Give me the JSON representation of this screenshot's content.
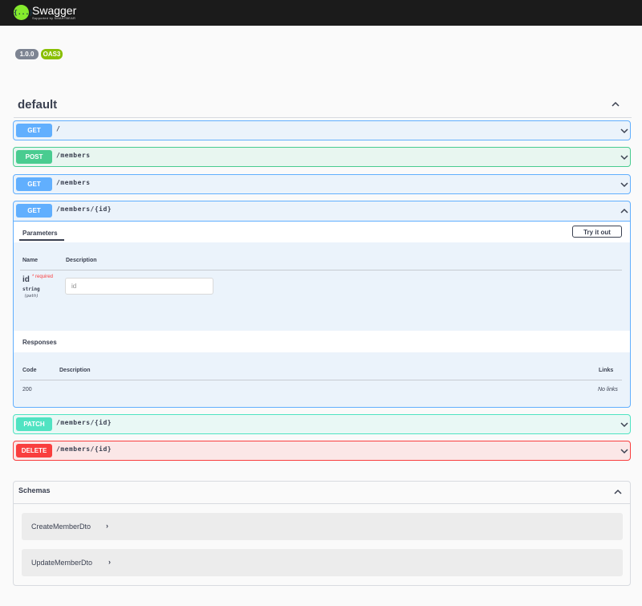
{
  "topbar": {
    "brand": "Swagger",
    "subtitle": "Supported by SMARTBEAR",
    "logo_glyph": "{...}"
  },
  "info": {
    "version": "1.0.0",
    "oas": "OAS3"
  },
  "tag": {
    "name": "default"
  },
  "operations": [
    {
      "method": "GET",
      "path": "/"
    },
    {
      "method": "POST",
      "path": "/members"
    },
    {
      "method": "GET",
      "path": "/members"
    },
    {
      "method": "GET",
      "path": "/members/{id}"
    },
    {
      "method": "PATCH",
      "path": "/members/{id}"
    },
    {
      "method": "DELETE",
      "path": "/members/{id}"
    }
  ],
  "expanded": {
    "tab": "Parameters",
    "try_label": "Try it out",
    "param_headers": {
      "name": "Name",
      "description": "Description"
    },
    "param": {
      "name": "id",
      "required": "* required",
      "type": "string",
      "in": "(path)",
      "placeholder": "id"
    },
    "responses_title": "Responses",
    "resp_headers": {
      "code": "Code",
      "description": "Description",
      "links": "Links"
    },
    "response": {
      "code": "200",
      "links": "No links"
    }
  },
  "schemas": {
    "title": "Schemas",
    "models": [
      "CreateMemberDto",
      "UpdateMemberDto"
    ]
  },
  "colors": {
    "get": "#61affe",
    "post": "#49cc90",
    "patch": "#50e3c2",
    "delete": "#f93e3e",
    "topbar": "#1b1b1b",
    "logo": "#85ea2d"
  }
}
